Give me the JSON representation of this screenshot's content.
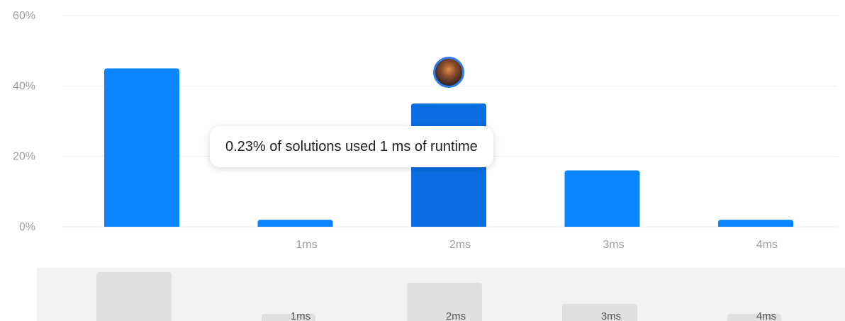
{
  "chart_data": {
    "type": "bar",
    "categories": [
      "",
      "1ms",
      "2ms",
      "3ms",
      "4ms"
    ],
    "values": [
      45,
      2,
      35,
      16,
      2
    ],
    "highlighted_index": 2,
    "y_ticks": [
      "0%",
      "20%",
      "40%",
      "60%"
    ],
    "ylim": [
      0,
      60
    ],
    "grid": true,
    "colors": {
      "bar": "#0a84ff",
      "bar_highlight": "#0a6de0",
      "grid": "#eeeeee",
      "tick": "#9e9e9e"
    }
  },
  "tooltip": {
    "text": "0.23% of solutions used 1 ms of runtime"
  },
  "avatar": {
    "icon": "user-avatar"
  },
  "minimap": {
    "labels": [
      "",
      "1ms",
      "2ms",
      "3ms",
      "4ms"
    ],
    "values": [
      45,
      2,
      35,
      16,
      2
    ]
  }
}
